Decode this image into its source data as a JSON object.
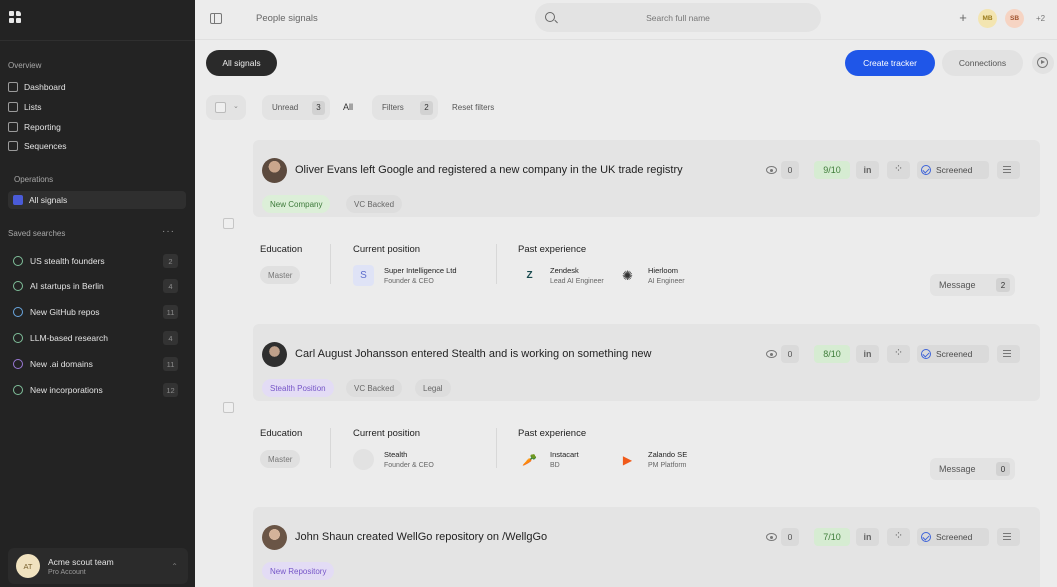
{
  "sidebar": {
    "overview_label": "Overview",
    "nav": [
      {
        "label": "Dashboard",
        "icon": "dashboard-icon"
      },
      {
        "label": "Lists",
        "icon": "lists-icon"
      },
      {
        "label": "Reporting",
        "icon": "reporting-icon"
      },
      {
        "label": "Sequences",
        "icon": "sequences-icon"
      }
    ],
    "operations_label": "Operations",
    "operations": [
      {
        "label": "All signals",
        "icon": "signals-icon",
        "active": true
      }
    ],
    "saved_label": "Saved searches",
    "saved_more": "···",
    "saved": [
      {
        "label": "US stealth founders",
        "count": "2",
        "color": "#8ac89f"
      },
      {
        "label": "AI startups in Berlin",
        "count": "4",
        "color": "#8ac89f"
      },
      {
        "label": "New GitHub repos",
        "count": "11",
        "color": "#6aa7e0"
      },
      {
        "label": "LLM-based research",
        "count": "4",
        "color": "#8ac89f"
      },
      {
        "label": "New .ai domains",
        "count": "11",
        "color": "#9a78d6"
      },
      {
        "label": "New incorporations",
        "count": "12",
        "color": "#8ac89f"
      }
    ],
    "account": {
      "initials": "AT",
      "name": "Acme scout team",
      "plan": "Pro Account"
    }
  },
  "topbar": {
    "page_name": "People signals",
    "search_placeholder": "Search full name",
    "plus": "+",
    "avatars": [
      "MB",
      "SB"
    ],
    "more": "+2"
  },
  "toolbar": {
    "all_signals": "All signals",
    "create_tracker": "Create tracker",
    "connections": "Connections"
  },
  "filters": {
    "unread_label": "Unread",
    "unread_count": "3",
    "all_label": "All",
    "filters_label": "Filters",
    "filters_count": "2",
    "reset_label": "Reset filters"
  },
  "labels": {
    "education": "Education",
    "current_position": "Current position",
    "past_experience": "Past experience",
    "screened": "Screened",
    "message": "Message",
    "linkedin": "in"
  },
  "signals": [
    {
      "headline": "Oliver Evans left Google and registered a new company in the UK trade registry",
      "tags": [
        {
          "label": "New Company",
          "style": "green"
        },
        {
          "label": "VC Backed",
          "style": "grey"
        }
      ],
      "views": "0",
      "score": "9/10",
      "education": "Master",
      "current": {
        "company": "Super Intelligence Ltd",
        "role": "Founder & CEO",
        "logo_letter": "S"
      },
      "past": [
        {
          "company": "Zendesk",
          "role": "Lead AI Engineer",
          "logo_letter": "Z"
        },
        {
          "company": "Hierloom",
          "role": "AI Engineer",
          "logo_letter": "✺"
        }
      ],
      "messages": "2"
    },
    {
      "headline": "Carl August Johansson entered Stealth and is working on something new",
      "tags": [
        {
          "label": "Stealth Position",
          "style": "purple"
        },
        {
          "label": "VC Backed",
          "style": "grey"
        },
        {
          "label": "Legal",
          "style": "grey"
        }
      ],
      "views": "0",
      "score": "8/10",
      "education": "Master",
      "current": {
        "company": "Stealth",
        "role": "Founder & CEO",
        "logo_letter": ""
      },
      "past": [
        {
          "company": "Instacart",
          "role": "BD",
          "logo_letter": "🥕"
        },
        {
          "company": "Zalando SE",
          "role": "PM Platform",
          "logo_letter": "▶"
        }
      ],
      "messages": "0"
    },
    {
      "headline": "John Shaun created WellGo repository on /WellgGo",
      "tags": [
        {
          "label": "New Repository",
          "style": "purple"
        }
      ],
      "views": "0",
      "score": "7/10"
    }
  ]
}
